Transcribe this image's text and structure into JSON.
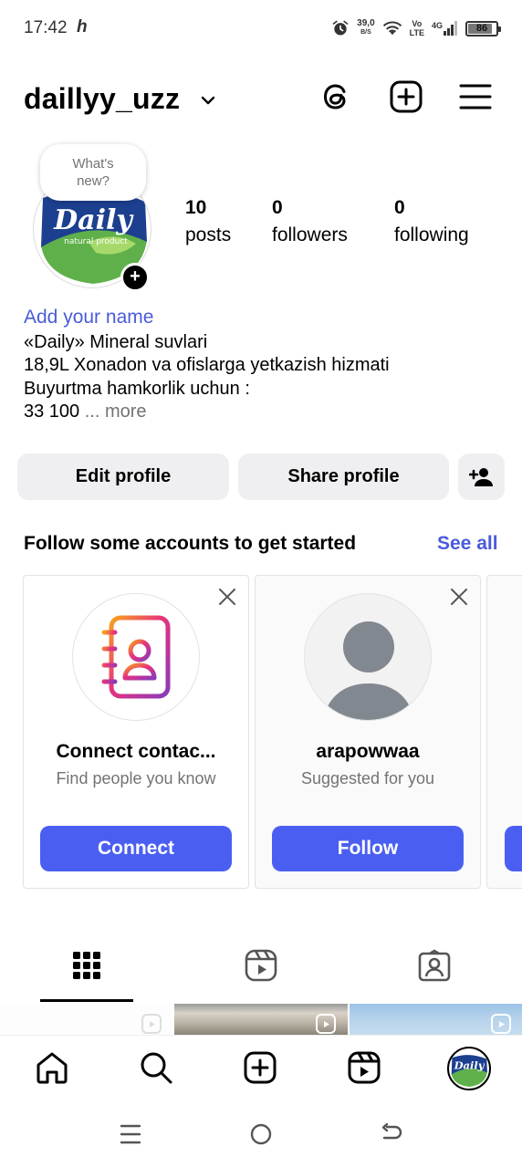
{
  "status_bar": {
    "time": "17:42",
    "app_icon": "h",
    "net_speed_value": "39,0",
    "net_speed_unit": "B/S",
    "volte_top": "Vo",
    "volte_bottom": "LTE",
    "network": "4G",
    "battery": "86",
    "battery_level_percent": 86
  },
  "header": {
    "username": "daillyy_uzz",
    "icons": [
      "threads-icon",
      "create-icon",
      "menu-icon"
    ]
  },
  "profile": {
    "note": "What's new?",
    "avatar_text": "Daily",
    "avatar_subtext": "natural product",
    "stats": {
      "posts": {
        "count": "10",
        "label": "posts"
      },
      "followers": {
        "count": "0",
        "label": "followers"
      },
      "following": {
        "count": "0",
        "label": "following"
      }
    },
    "add_name": "Add your name",
    "bio": [
      "«Daily» Mineral suvlari",
      "18,9L Xonadon va ofislarga yetkazish hizmati",
      "Buyurtma hamkorlik uchun :"
    ],
    "bio_last": "33 100",
    "bio_more": "... more"
  },
  "actions": {
    "edit": "Edit profile",
    "share": "Share profile",
    "add_user_icon": "add-user-icon"
  },
  "suggestions": {
    "title": "Follow some accounts to get started",
    "see_all": "See all",
    "cards": [
      {
        "name": "Connect contac...",
        "subtitle": "Find people you know",
        "button": "Connect"
      },
      {
        "name": "arapowwaa",
        "subtitle": "Suggested for you",
        "button": "Follow"
      }
    ]
  },
  "tabs": [
    "grid-icon",
    "reels-icon",
    "tagged-icon"
  ],
  "bottom_nav": [
    "home-icon",
    "search-icon",
    "create-icon",
    "reels-icon",
    "profile-avatar"
  ],
  "system_nav": [
    "recents-icon",
    "home-circle-icon",
    "back-icon"
  ],
  "colors": {
    "accent_blue": "#4a5ff2",
    "link_blue": "#4a5bdb",
    "button_gray": "#efeff1",
    "secondary_text": "#737373"
  }
}
